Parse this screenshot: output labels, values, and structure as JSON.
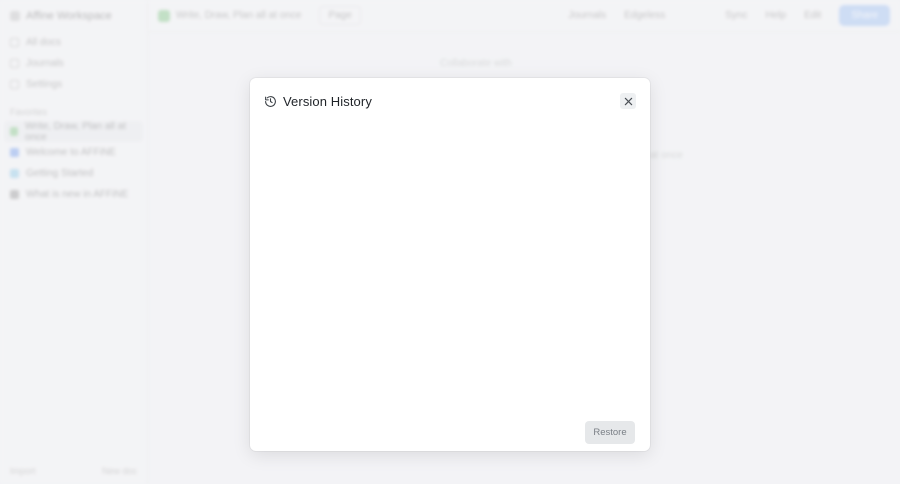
{
  "background": {
    "workspace_name": "Affine Workspace",
    "sidebar_items": [
      "All docs",
      "Journals",
      "Settings"
    ],
    "collections_label": "Favorites",
    "spaces": [
      {
        "label": "Write, Draw, Plan all at once",
        "color": "#6fbf73"
      },
      {
        "label": "Welcome to AFFiNE",
        "color": "#5b8def"
      },
      {
        "label": "Getting Started",
        "color": "#7cc3e8"
      },
      {
        "label": "What is new in AFFiNE",
        "color": "#888888"
      }
    ],
    "footer_left": "Import",
    "footer_right": "New doc",
    "page_title": "Write, Draw, Plan all at once",
    "mode_pill": "Page",
    "mid_actions": [
      "Journals",
      "Edgeless"
    ],
    "right_actions": [
      "Sync",
      "Help",
      "Edit"
    ],
    "share_label": "Share",
    "doc_hint": "Collaborate with",
    "doc_hint2": "at once"
  },
  "modal": {
    "title": "Version History",
    "restore_label": "Restore"
  },
  "colors": {
    "modal_bg": "#ffffff",
    "restore_bg": "#e6e8ea",
    "close_bg": "#eef0f2"
  }
}
